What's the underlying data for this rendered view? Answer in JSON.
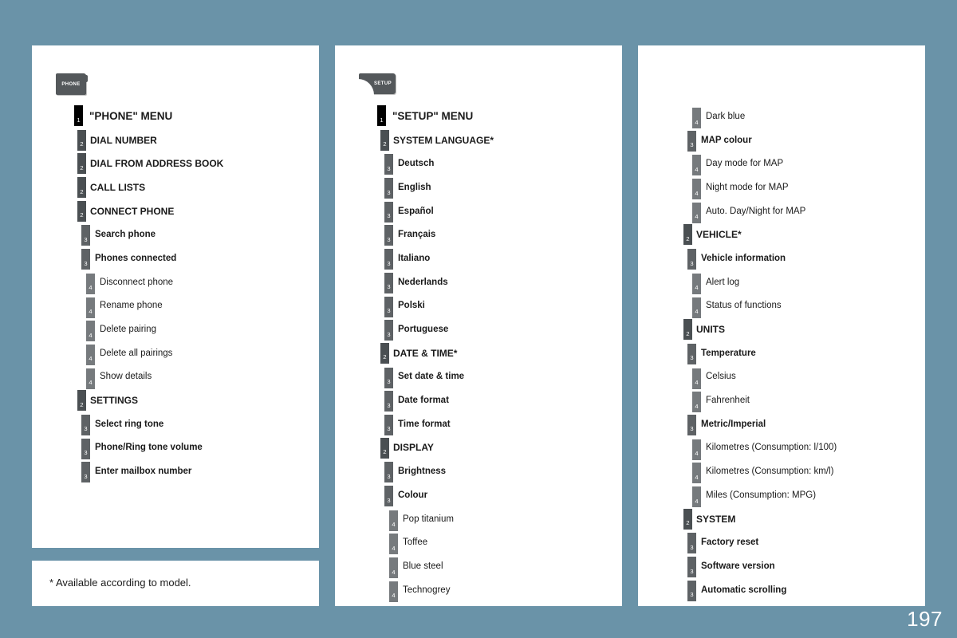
{
  "page": {
    "background_color": "#6a93a8",
    "page_number": "197"
  },
  "footnote": {
    "text": "* Available according to model."
  },
  "panels": [
    {
      "id": "phone",
      "icon": {
        "name": "phone-menu-icon",
        "label": "PHONE"
      },
      "items": [
        {
          "level": 1,
          "label": "\"PHONE\" MENU"
        },
        {
          "level": 2,
          "label": "DIAL NUMBER"
        },
        {
          "level": 2,
          "label": "DIAL FROM ADDRESS BOOK"
        },
        {
          "level": 2,
          "label": "CALL LISTS"
        },
        {
          "level": 2,
          "label": "CONNECT PHONE"
        },
        {
          "level": 3,
          "label": "Search phone"
        },
        {
          "level": 3,
          "label": "Phones connected"
        },
        {
          "level": 4,
          "label": "Disconnect phone"
        },
        {
          "level": 4,
          "label": "Rename phone"
        },
        {
          "level": 4,
          "label": "Delete pairing"
        },
        {
          "level": 4,
          "label": "Delete all pairings"
        },
        {
          "level": 4,
          "label": "Show details"
        },
        {
          "level": 2,
          "label": "SETTINGS"
        },
        {
          "level": 3,
          "label": "Select ring tone"
        },
        {
          "level": 3,
          "label": "Phone/Ring tone volume"
        },
        {
          "level": 3,
          "label": "Enter mailbox number"
        }
      ]
    },
    {
      "id": "setup",
      "icon": {
        "name": "setup-menu-icon",
        "label": "SETUP"
      },
      "items": [
        {
          "level": 1,
          "label": "\"SETUP\" MENU"
        },
        {
          "level": 2,
          "label": "SYSTEM LANGUAGE*"
        },
        {
          "level": 3,
          "label": "Deutsch"
        },
        {
          "level": 3,
          "label": "English"
        },
        {
          "level": 3,
          "label": "Español"
        },
        {
          "level": 3,
          "label": "Français"
        },
        {
          "level": 3,
          "label": "Italiano"
        },
        {
          "level": 3,
          "label": "Nederlands"
        },
        {
          "level": 3,
          "label": "Polski"
        },
        {
          "level": 3,
          "label": "Portuguese"
        },
        {
          "level": 2,
          "label": "DATE & TIME*"
        },
        {
          "level": 3,
          "label": "Set date & time"
        },
        {
          "level": 3,
          "label": "Date format"
        },
        {
          "level": 3,
          "label": "Time format"
        },
        {
          "level": 2,
          "label": "DISPLAY"
        },
        {
          "level": 3,
          "label": "Brightness"
        },
        {
          "level": 3,
          "label": "Colour"
        },
        {
          "level": 4,
          "label": "Pop titanium"
        },
        {
          "level": 4,
          "label": "Toffee"
        },
        {
          "level": 4,
          "label": "Blue steel"
        },
        {
          "level": 4,
          "label": "Technogrey"
        }
      ]
    },
    {
      "id": "setup-continued",
      "icon": null,
      "items": [
        {
          "level": 4,
          "label": "Dark blue"
        },
        {
          "level": 3,
          "label": "MAP colour"
        },
        {
          "level": 4,
          "label": "Day mode for MAP"
        },
        {
          "level": 4,
          "label": "Night mode for MAP"
        },
        {
          "level": 4,
          "label": "Auto. Day/Night for MAP"
        },
        {
          "level": 2,
          "label": "VEHICLE*"
        },
        {
          "level": 3,
          "label": "Vehicle information"
        },
        {
          "level": 4,
          "label": "Alert log"
        },
        {
          "level": 4,
          "label": "Status of functions"
        },
        {
          "level": 2,
          "label": "UNITS"
        },
        {
          "level": 3,
          "label": "Temperature"
        },
        {
          "level": 4,
          "label": "Celsius"
        },
        {
          "level": 4,
          "label": "Fahrenheit"
        },
        {
          "level": 3,
          "label": "Metric/Imperial"
        },
        {
          "level": 4,
          "label": "Kilometres (Consumption: l/100)"
        },
        {
          "level": 4,
          "label": "Kilometres (Consumption: km/l)"
        },
        {
          "level": 4,
          "label": "Miles (Consumption: MPG)"
        },
        {
          "level": 2,
          "label": "SYSTEM"
        },
        {
          "level": 3,
          "label": "Factory reset"
        },
        {
          "level": 3,
          "label": "Software version"
        },
        {
          "level": 3,
          "label": "Automatic scrolling"
        }
      ]
    }
  ]
}
